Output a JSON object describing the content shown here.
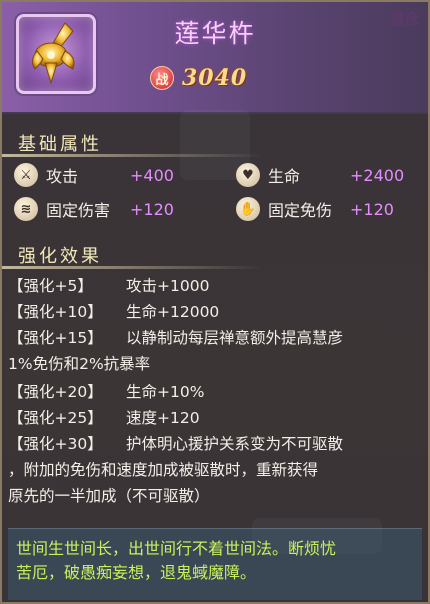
{
  "item": {
    "name": "莲华杵",
    "owner": "慧彦",
    "power_badge": "战",
    "power_value": "3040",
    "icon": "golden-vajra-pestle-icon"
  },
  "base_attributes": {
    "title": "基础属性",
    "items": [
      {
        "icon": "sword-icon",
        "label": "攻击",
        "value": "+400"
      },
      {
        "icon": "heart-icon",
        "label": "生命",
        "value": "+2400"
      },
      {
        "icon": "claw-icon",
        "label": "固定伤害",
        "value": "+120"
      },
      {
        "icon": "palm-icon",
        "label": "固定免伤",
        "value": "+120"
      }
    ]
  },
  "enhance": {
    "title": "强化效果",
    "rows": [
      {
        "level": "【强化+5】",
        "effect": "攻击+1000"
      },
      {
        "level": "【强化+10】",
        "effect": "生命+12000"
      },
      {
        "level": "【强化+15】",
        "effect": "以静制动每层禅意额外提高慧彦",
        "cont": "1%免伤和2%抗暴率"
      },
      {
        "level": "【强化+20】",
        "effect": "生命+10%"
      },
      {
        "level": "【强化+25】",
        "effect": "速度+120"
      },
      {
        "level": "【强化+30】",
        "effect": "护体明心援护关系变为不可驱散",
        "cont": "，附加的免伤和速度加成被驱散时，重新获得",
        "cont2": "原先的一半加成（不可驱散）"
      }
    ]
  },
  "poem": {
    "line1": "世间生世间长，出世间行不着世间法。断烦忧",
    "line2": "苦厄，破愚痴妄想，退鬼蜮魔障。"
  },
  "colors": {
    "attr_value": "#e58cff",
    "poem_text": "#c9f25a",
    "power_value": "#ffd98a"
  }
}
